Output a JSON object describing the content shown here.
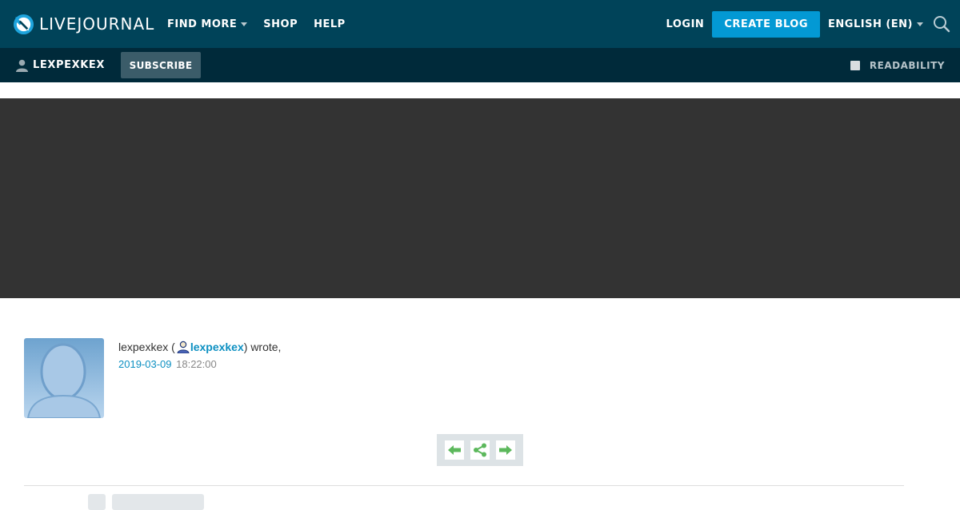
{
  "header": {
    "logo_text": "LIVEJOURNAL",
    "nav": [
      {
        "label": "FIND MORE",
        "has_dropdown": true
      },
      {
        "label": "SHOP",
        "has_dropdown": false
      },
      {
        "label": "HELP",
        "has_dropdown": false
      }
    ],
    "login_label": "LOGIN",
    "create_blog_label": "CREATE BLOG",
    "language_label": "ENGLISH (EN)",
    "colors": {
      "topbar": "#004359",
      "button": "#0399d4"
    }
  },
  "userbar": {
    "journal_name": "LEXPEXKEX",
    "subscribe_label": "SUBSCRIBE",
    "readability_label": "READABILITY",
    "readability_checked": false,
    "colors": {
      "bar": "#002a3a",
      "subscribe": "#3b5c69"
    }
  },
  "banner": {
    "color": "#333333"
  },
  "post": {
    "author_plain": "lexpexkex (",
    "author_link": "lexpexkex",
    "wrote_suffix": ") wrote,",
    "date": "2019-03-09",
    "time": "18:22:00",
    "link_color": "#0d90c2"
  },
  "controls": {
    "icons": [
      "arrow-left-icon",
      "share-icon",
      "arrow-right-icon"
    ],
    "icon_color": "#5cb85c"
  }
}
